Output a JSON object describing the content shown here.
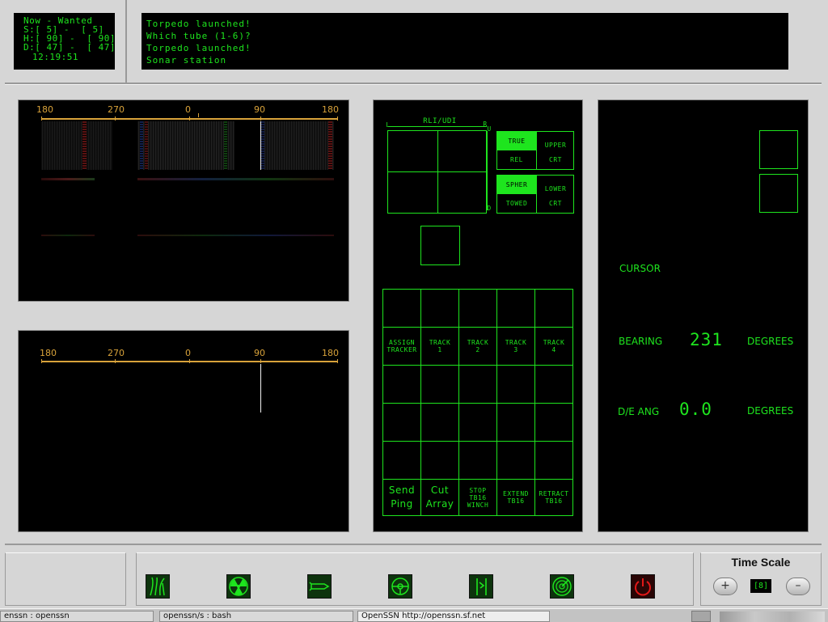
{
  "status": {
    "header": "Now - Wanted",
    "speed": "S:[ 5] -  [ 5]",
    "heading": "H:[ 90] -  [ 90]",
    "depth": "D:[ 47] -  [ 47]",
    "time": "12:19:51"
  },
  "messages": [
    "Torpedo launched!",
    "Which tube (1-6)?",
    "Torpedo launched!",
    "Sonar station"
  ],
  "bearing_labels": [
    "180",
    "270",
    "0",
    "90",
    "180"
  ],
  "display_control": {
    "title": "RLI/UDI",
    "left_mark": "L",
    "right_mark": "R",
    "up_mark": "U",
    "down_mark": "D",
    "upper": {
      "opt1": "TRUE",
      "opt2": "REL",
      "crt": "UPPER\nCRT"
    },
    "lower": {
      "opt1": "SPHER",
      "opt2": "TOWED",
      "crt": "LOWER\nCRT"
    }
  },
  "tracker": {
    "assign": "ASSIGN\nTRACKER",
    "tracks": [
      "TRACK\n1",
      "TRACK\n2",
      "TRACK\n3",
      "TRACK\n4"
    ]
  },
  "actions": {
    "send_ping": "Send\nPing",
    "cut_array": "Cut\nArray",
    "stop_winch": "STOP\nTB16\nWINCH",
    "extend": "EXTEND\nTB16",
    "retract": "RETRACT\nTB16"
  },
  "readout": {
    "cursor_label": "CURSOR",
    "bearing_label": "BEARING",
    "bearing_value": "231",
    "bearing_unit": "DEGREES",
    "de_label": "D/E ANG",
    "de_value": "0.0",
    "de_unit": "DEGREES"
  },
  "toolbar": {
    "icons": [
      "sonar-icon",
      "radiation-icon",
      "torpedo-icon",
      "helm-icon",
      "periscope-icon",
      "radar-icon",
      "power-icon"
    ]
  },
  "time_scale": {
    "title": "Time Scale",
    "plus": "+",
    "value": "[8]",
    "minus": "–"
  },
  "taskbar": {
    "items": [
      "enssn : openssn",
      "openssn/s : bash",
      "OpenSSN http://openssn.sf.net"
    ]
  },
  "colors": {
    "screen_green": "#1ee51e",
    "bearing_orange": "#d8a23a",
    "panel_bg": "#000000"
  }
}
